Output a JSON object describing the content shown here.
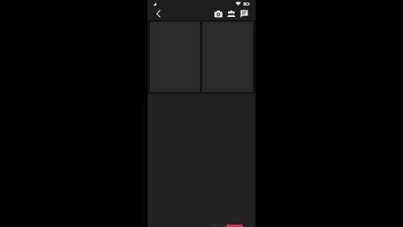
{
  "status_bar": {
    "icons": [
      "signal-icon",
      "wifi-icon",
      "battery-icon"
    ]
  },
  "toolbar": {
    "back_icon": "chevron-left-icon",
    "camera_icon": "camera-icon",
    "people_icon": "people-icon",
    "message_icon": "message-icon"
  },
  "colors": {
    "background": "#000000",
    "screen": "#1f1e1f",
    "tile": "#2a2a2a",
    "icon": "#e6e6e6",
    "accent": "#e0314b"
  }
}
